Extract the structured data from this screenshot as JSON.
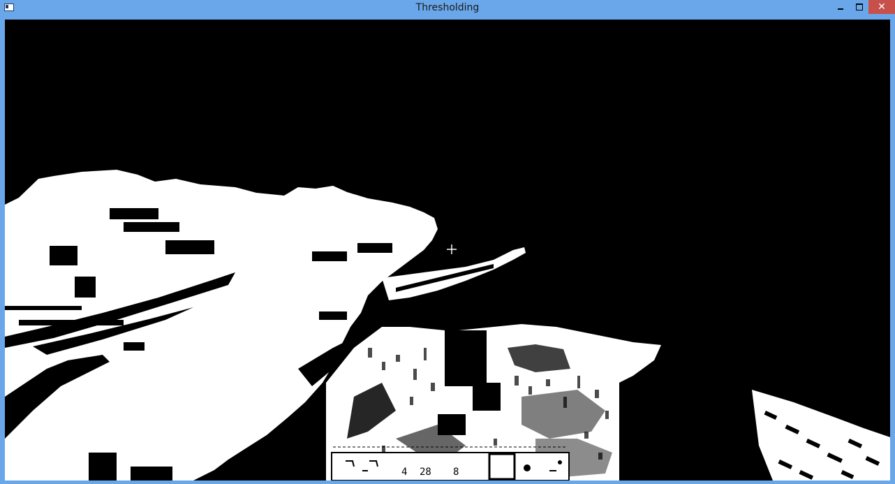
{
  "window": {
    "title": "Thresholding",
    "controls": {
      "minimize": "minimize",
      "maximize": "maximize",
      "close": "close"
    }
  },
  "image": {
    "description_mode": "binary-threshold",
    "colors": {
      "background": "#000000",
      "foreground": "#ffffff",
      "titlebar": "#6aa7ea",
      "close_button": "#c7504b"
    },
    "hotbar": {
      "numbers": [
        "4",
        "28",
        "8"
      ]
    }
  }
}
